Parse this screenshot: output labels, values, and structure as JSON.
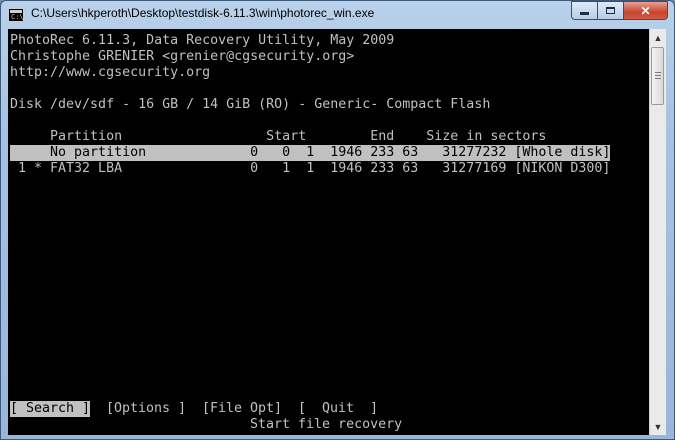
{
  "window": {
    "title": "C:\\Users\\hkperoth\\Desktop\\testdisk-6.11.3\\win\\photorec_win.exe"
  },
  "console": {
    "header": [
      "PhotoRec 6.11.3, Data Recovery Utility, May 2009",
      "Christophe GRENIER <grenier@cgsecurity.org>",
      "http://www.cgsecurity.org"
    ],
    "disk_line": "Disk /dev/sdf - 16 GB / 14 GiB (RO) - Generic- Compact Flash",
    "column_header": "     Partition                  Start        End    Size in sectors",
    "partitions": [
      {
        "text": "     No partition             0   0  1  1946 233 63   31277232 [Whole disk]",
        "selected": true
      },
      {
        "text": " 1 * FAT32 LBA                0   1  1  1946 233 63   31277169 [NIKON D300]",
        "selected": false
      }
    ],
    "menu": [
      {
        "label": "[ Search ]",
        "active": true
      },
      {
        "label": "[Options ]",
        "active": false
      },
      {
        "label": "[File Opt]",
        "active": false
      },
      {
        "label": "[  Quit  ]",
        "active": false
      }
    ],
    "hint": "Start file recovery"
  }
}
